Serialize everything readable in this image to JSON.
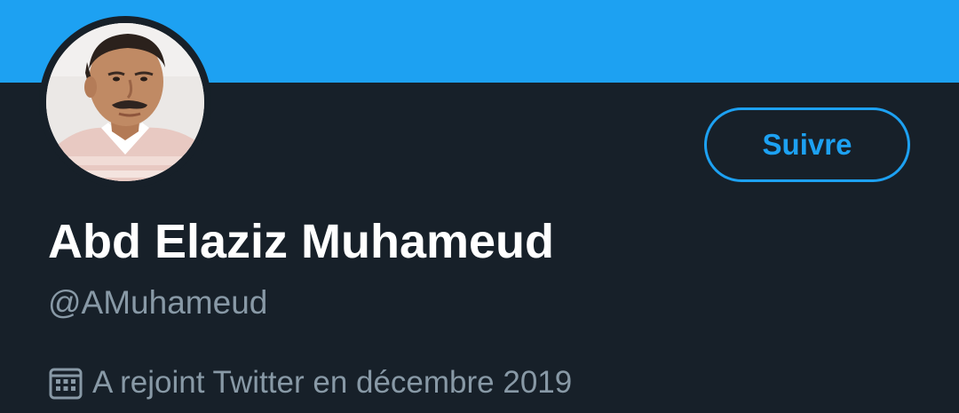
{
  "profile": {
    "display_name": "Abd Elaziz Muhameud",
    "handle": "@AMuhameud",
    "joined_text": "A rejoint Twitter en décembre 2019",
    "avatar_icon": "profile-photo",
    "calendar_icon": "calendar-icon"
  },
  "actions": {
    "follow_label": "Suivre"
  },
  "colors": {
    "banner": "#1da1f2",
    "background": "#172029",
    "accent": "#1da1f2",
    "secondary_text": "#8899a6",
    "primary_text": "#ffffff"
  }
}
